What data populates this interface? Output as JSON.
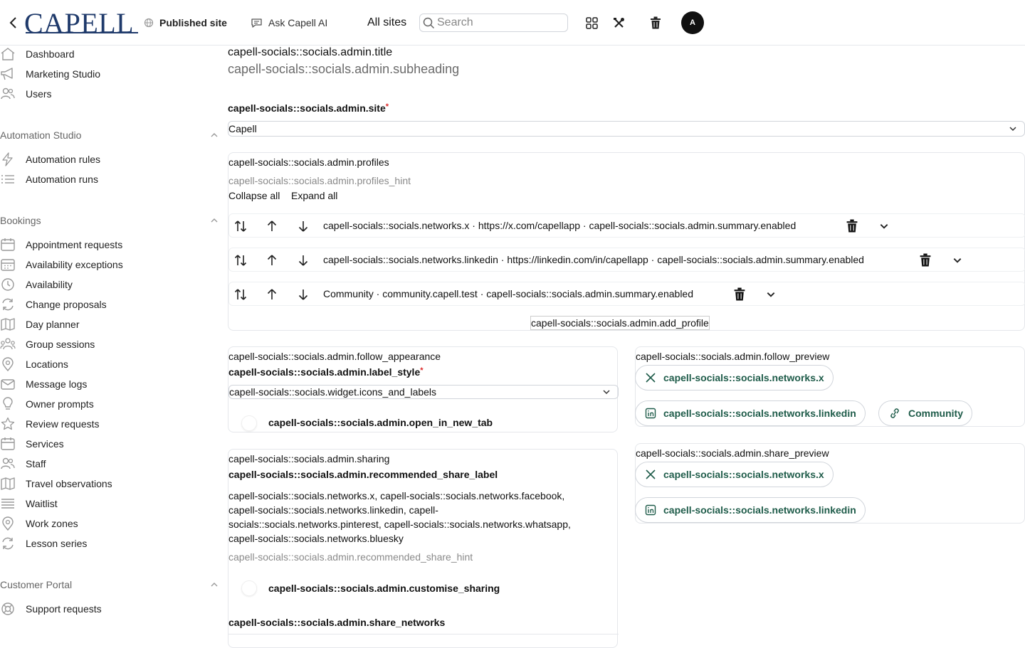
{
  "header": {
    "logo": "CAPELL",
    "published_site": "Published site",
    "ask_ai": "Ask Capell AI",
    "all_sites": "All sites",
    "search_placeholder": "Search",
    "avatar": "A"
  },
  "sidebar": {
    "top_items": [
      {
        "label": "Dashboard",
        "icon": "home-icon"
      },
      {
        "label": "Marketing Studio",
        "icon": "megaphone-icon"
      },
      {
        "label": "Users",
        "icon": "users-icon"
      }
    ],
    "sections": [
      {
        "title": "Automation Studio",
        "items": [
          {
            "label": "Automation rules",
            "icon": "bolt-icon"
          },
          {
            "label": "Automation runs",
            "icon": "list-icon"
          }
        ]
      },
      {
        "title": "Bookings",
        "items": [
          {
            "label": "Appointment requests",
            "icon": "calendar-icon"
          },
          {
            "label": "Availability exceptions",
            "icon": "calendar-days-icon"
          },
          {
            "label": "Availability",
            "icon": "clock-icon"
          },
          {
            "label": "Change proposals",
            "icon": "refresh-icon"
          },
          {
            "label": "Day planner",
            "icon": "map-icon"
          },
          {
            "label": "Group sessions",
            "icon": "user-group-icon"
          },
          {
            "label": "Locations",
            "icon": "map-pin-icon"
          },
          {
            "label": "Message logs",
            "icon": "envelope-icon"
          },
          {
            "label": "Owner prompts",
            "icon": "lightbulb-icon"
          },
          {
            "label": "Review requests",
            "icon": "star-icon"
          },
          {
            "label": "Services",
            "icon": "calendar-icon"
          },
          {
            "label": "Staff",
            "icon": "users-icon"
          },
          {
            "label": "Travel observations",
            "icon": "map-icon"
          },
          {
            "label": "Waitlist",
            "icon": "bars-icon"
          },
          {
            "label": "Work zones",
            "icon": "map-pin-icon"
          },
          {
            "label": "Lesson series",
            "icon": "refresh-icon"
          }
        ]
      },
      {
        "title": "Customer Portal",
        "items": [
          {
            "label": "Support requests",
            "icon": "lifebuoy-icon"
          }
        ]
      }
    ]
  },
  "main": {
    "title": "capell-socials::socials.admin.title",
    "subheading": "capell-socials::socials.admin.subheading",
    "site_label": "capell-socials::socials.admin.site",
    "site_value": "Capell",
    "profiles": {
      "label": "capell-socials::socials.admin.profiles",
      "hint": "capell-socials::socials.admin.profiles_hint",
      "collapse_all": "Collapse all",
      "expand_all": "Expand all",
      "rows": [
        "capell-socials::socials.networks.x · https://x.com/capellapp · capell-socials::socials.admin.summary.enabled",
        "capell-socials::socials.networks.linkedin · https://linkedin.com/in/capellapp · capell-socials::socials.admin.summary.enabled",
        "Community · community.capell.test · capell-socials::socials.admin.summary.enabled"
      ],
      "add_profile": "capell-socials::socials.admin.add_profile"
    },
    "follow": {
      "title": "capell-socials::socials.admin.follow_appearance",
      "label_style": "capell-socials::socials.admin.label_style",
      "label_style_value": "capell-socials::socials.widget.icons_and_labels",
      "open_new_tab": "capell-socials::socials.admin.open_in_new_tab"
    },
    "follow_preview": {
      "title": "capell-socials::socials.admin.follow_preview",
      "x": "capell-socials::socials.networks.x",
      "linkedin": "capell-socials::socials.networks.linkedin",
      "community": "Community"
    },
    "sharing": {
      "title": "capell-socials::socials.admin.sharing",
      "recommended_label": "capell-socials::socials.admin.recommended_share_label",
      "recommended_lines": [
        "capell-socials::socials.networks.x, capell-socials::socials.networks.facebook,",
        "capell-socials::socials.networks.linkedin, capell-",
        "socials::socials.networks.pinterest, capell-socials::socials.networks.whatsapp,",
        "capell-socials::socials.networks.bluesky"
      ],
      "recommended_hint": "capell-socials::socials.admin.recommended_share_hint",
      "customise": "capell-socials::socials.admin.customise_sharing",
      "share_networks": "capell-socials::socials.admin.share_networks"
    },
    "share_preview": {
      "title": "capell-socials::socials.admin.share_preview",
      "x": "capell-socials::socials.networks.x",
      "linkedin": "capell-socials::socials.networks.linkedin"
    }
  },
  "colors": {
    "brand": "#1f3a6b",
    "pill_text": "#1f5c4a",
    "required": "#dc2626"
  }
}
